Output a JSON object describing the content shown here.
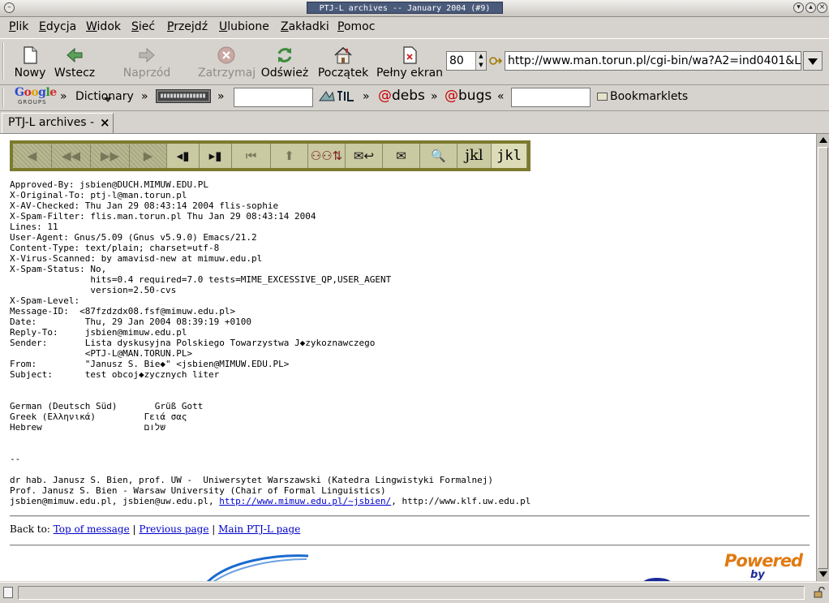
{
  "window": {
    "title": "PTJ-L archives -- January 2004 (#9)"
  },
  "menu": [
    "Plik",
    "Edycja",
    "Widok",
    "Sieć",
    "Przejdź",
    "Ulubione",
    "Zakładki",
    "Pomoc"
  ],
  "toolbar": {
    "new_label": "Nowy",
    "back_label": "Wstecz",
    "forward_label": "Naprzód",
    "stop_label": "Zatrzymaj",
    "reload_label": "Odśwież",
    "home_label": "Początek",
    "fullscreen_label": "Pełny ekran",
    "zoom_value": "80",
    "url": "http://www.man.torun.pl/cgi-bin/wa?A2=ind0401&L="
  },
  "bookmarks": {
    "dictionary": "Dictionary",
    "debs": "debs",
    "bugs": "bugs",
    "bookmarklets": "Bookmarklets",
    "sep": "»",
    "sep_left": "«"
  },
  "tab": {
    "label": "PTJ-L archives -",
    "close": "×"
  },
  "mail_nav": {
    "jkl_label": "jkl"
  },
  "mail": {
    "headers": [
      "Approved-By: jsbien@DUCH.MIMUW.EDU.PL",
      "X-Original-To: ptj-l@man.torun.pl",
      "X-AV-Checked: Thu Jan 29 08:43:14 2004 flis-sophie",
      "X-Spam-Filter: flis.man.torun.pl Thu Jan 29 08:43:14 2004",
      "Lines: 11",
      "User-Agent: Gnus/5.09 (Gnus v5.9.0) Emacs/21.2",
      "Content-Type: text/plain; charset=utf-8",
      "X-Virus-Scanned: by amavisd-new at mimuw.edu.pl",
      "X-Spam-Status: No,",
      "               hits=0.4 required=7.0 tests=MIME_EXCESSIVE_QP,USER_AGENT",
      "               version=2.50-cvs",
      "X-Spam-Level:",
      "Message-ID:  <87fzdzdx08.fsf@mimuw.edu.pl>",
      "Date:         Thu, 29 Jan 2004 08:39:19 +0100",
      "Reply-To:     jsbien@mimuw.edu.pl",
      "Sender:       Lista dyskusyjna Polskiego Towarzystwa J◆zykoznawczego",
      "              <PTJ-L@MAN.TORUN.PL>",
      "From:         \"Janusz S. Bie◆\" <jsbien@MIMUW.EDU.PL>",
      "Subject:      test obcoj◆zycznych liter"
    ],
    "body": [
      "",
      "",
      "German (Deutsch Süd)       Grüß Gott",
      "Greek (Ελληνικά)         Γειά σας",
      "Hebrew                   שלום",
      "",
      "",
      "--",
      "",
      "dr hab. Janusz S. Bien, prof. UW -  Uniwersytet Warszawski (Katedra Lingwistyki Formalnej)",
      "Prof. Janusz S. Bien - Warsaw University (Chair of Formal Linguistics)"
    ],
    "sig_prefix": "jsbien@mimuw.edu.pl, jsbien@uw.edu.pl, ",
    "sig_link": "http://www.mimuw.edu.pl/~jsbien/",
    "sig_suffix": ", http://www.klf.uw.edu.pl"
  },
  "backto": {
    "label": "Back to: ",
    "top": "Top of message",
    "prev": "Previous page",
    "main": "Main PTJ-L page",
    "sep": " | "
  },
  "footer": {
    "powered": "Powered",
    "by": "by"
  }
}
